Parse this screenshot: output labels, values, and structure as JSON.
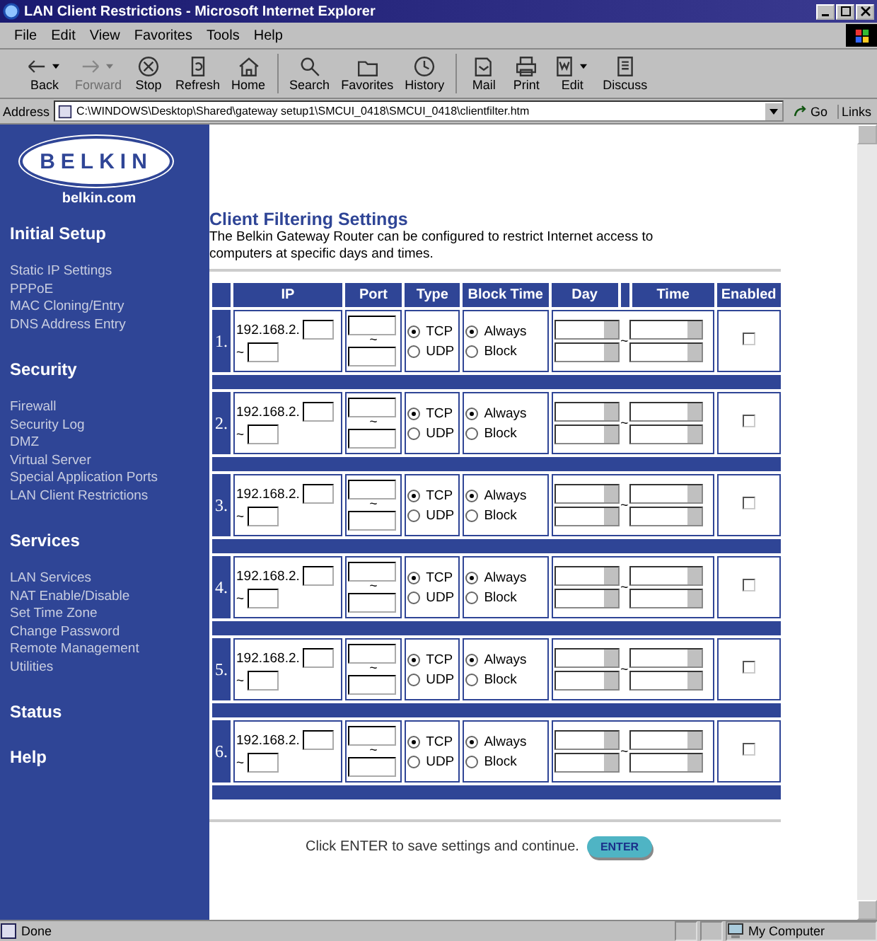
{
  "window": {
    "title": "LAN Client Restrictions - Microsoft Internet Explorer"
  },
  "menu": [
    "File",
    "Edit",
    "View",
    "Favorites",
    "Tools",
    "Help"
  ],
  "toolbar": [
    {
      "label": "Back",
      "kind": "back",
      "disabled": false,
      "dropdown": true
    },
    {
      "label": "Forward",
      "kind": "forward",
      "disabled": true,
      "dropdown": true
    },
    {
      "label": "Stop",
      "kind": "stop",
      "disabled": false,
      "dropdown": false
    },
    {
      "label": "Refresh",
      "kind": "refresh",
      "disabled": false,
      "dropdown": false
    },
    {
      "label": "Home",
      "kind": "home",
      "disabled": false,
      "dropdown": false
    },
    {
      "label": "Search",
      "kind": "search",
      "disabled": false,
      "dropdown": false
    },
    {
      "label": "Favorites",
      "kind": "favorites",
      "disabled": false,
      "dropdown": false
    },
    {
      "label": "History",
      "kind": "history",
      "disabled": false,
      "dropdown": false
    },
    {
      "label": "Mail",
      "kind": "mail",
      "disabled": false,
      "dropdown": false
    },
    {
      "label": "Print",
      "kind": "print",
      "disabled": false,
      "dropdown": false
    },
    {
      "label": "Edit",
      "kind": "edit",
      "disabled": false,
      "dropdown": true
    },
    {
      "label": "Discuss",
      "kind": "discuss",
      "disabled": false,
      "dropdown": false
    }
  ],
  "address_bar": {
    "label": "Address",
    "value": "C:\\WINDOWS\\Desktop\\Shared\\gateway setup1\\SMCUI_0418\\SMCUI_0418\\clientfilter.htm",
    "go": "Go",
    "links": "Links"
  },
  "sidebar": {
    "logo": "BELKIN",
    "site": "belkin.com",
    "sections": [
      {
        "title": "Initial Setup",
        "items": [
          "Static IP Settings",
          "PPPoE",
          "MAC Cloning/Entry",
          "DNS Address Entry"
        ]
      },
      {
        "title": "Security",
        "items": [
          "Firewall",
          "Security Log",
          "DMZ",
          "Virtual Server",
          "Special Application Ports",
          "LAN Client Restrictions"
        ]
      },
      {
        "title": "Services",
        "items": [
          "LAN Services",
          "NAT Enable/Disable",
          "Set Time Zone",
          "Change  Password",
          "Remote Management",
          "Utilities"
        ]
      },
      {
        "title": "Status"
      },
      {
        "title": "Help"
      }
    ]
  },
  "page": {
    "title": "Client Filtering Settings",
    "description": "The Belkin Gateway Router can be configured to restrict Internet access to computers at specific days and times."
  },
  "table": {
    "columns": [
      "IP",
      "Port",
      "Type",
      "Block Time",
      "Day",
      "Time",
      "Enabled"
    ],
    "rows": [
      {
        "number": "1.",
        "ip_prefix": "192.168.2.",
        "tilde": "~",
        "port_tilde": "~",
        "type": [
          {
            "label": "TCP",
            "selected": true
          },
          {
            "label": "UDP",
            "selected": false
          }
        ],
        "block_time": [
          {
            "label": "Always",
            "selected": true
          },
          {
            "label": "Block",
            "selected": false
          }
        ],
        "day_tilde": "~",
        "enabled": false
      },
      {
        "number": "2.",
        "ip_prefix": "192.168.2.",
        "tilde": "~",
        "port_tilde": "~",
        "type": [
          {
            "label": "TCP",
            "selected": true
          },
          {
            "label": "UDP",
            "selected": false
          }
        ],
        "block_time": [
          {
            "label": "Always",
            "selected": true
          },
          {
            "label": "Block",
            "selected": false
          }
        ],
        "day_tilde": "~",
        "enabled": false
      },
      {
        "number": "3.",
        "ip_prefix": "192.168.2.",
        "tilde": "~",
        "port_tilde": "~",
        "type": [
          {
            "label": "TCP",
            "selected": true
          },
          {
            "label": "UDP",
            "selected": false
          }
        ],
        "block_time": [
          {
            "label": "Always",
            "selected": true
          },
          {
            "label": "Block",
            "selected": false
          }
        ],
        "day_tilde": "~",
        "enabled": false
      },
      {
        "number": "4.",
        "ip_prefix": "192.168.2.",
        "tilde": "~",
        "port_tilde": "~",
        "type": [
          {
            "label": "TCP",
            "selected": true
          },
          {
            "label": "UDP",
            "selected": false
          }
        ],
        "block_time": [
          {
            "label": "Always",
            "selected": true
          },
          {
            "label": "Block",
            "selected": false
          }
        ],
        "day_tilde": "~",
        "enabled": false
      },
      {
        "number": "5.",
        "ip_prefix": "192.168.2.",
        "tilde": "~",
        "port_tilde": "~",
        "type": [
          {
            "label": "TCP",
            "selected": true
          },
          {
            "label": "UDP",
            "selected": false
          }
        ],
        "block_time": [
          {
            "label": "Always",
            "selected": true
          },
          {
            "label": "Block",
            "selected": false
          }
        ],
        "day_tilde": "~",
        "enabled": false
      },
      {
        "number": "6.",
        "ip_prefix": "192.168.2.",
        "tilde": "~",
        "port_tilde": "~",
        "type": [
          {
            "label": "TCP",
            "selected": true
          },
          {
            "label": "UDP",
            "selected": false
          }
        ],
        "block_time": [
          {
            "label": "Always",
            "selected": true
          },
          {
            "label": "Block",
            "selected": false
          }
        ],
        "day_tilde": "~",
        "enabled": false
      }
    ]
  },
  "footer": {
    "text": "Click ENTER to save settings and continue.",
    "button": "ENTER"
  },
  "status_bar": {
    "text": "Done",
    "zone": "My Computer"
  }
}
